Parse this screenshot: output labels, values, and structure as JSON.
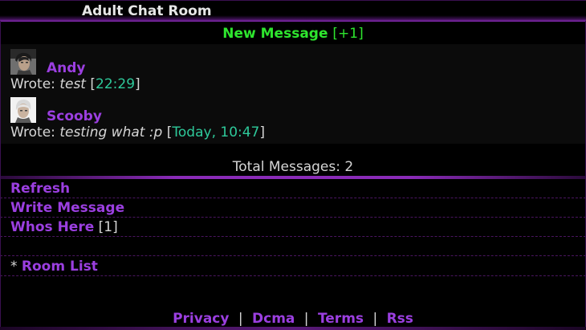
{
  "header": {
    "title": "Adult Chat Room"
  },
  "notice": {
    "label": "New Message",
    "count": "[+1]"
  },
  "messages": [
    {
      "username": "Andy",
      "prefix": "Wrote: ",
      "text": "test",
      "time_open": "[",
      "time": "22:29",
      "time_close": "]",
      "avatar_icon": "dark-haired-man-avatar-icon"
    },
    {
      "username": "Scooby",
      "prefix": "Wrote: ",
      "text": "testing what :p",
      "time_open": "[",
      "time": "Today, 10:47",
      "time_close": "]",
      "avatar_icon": "white-haired-man-avatar-icon"
    }
  ],
  "total": {
    "label": "Total Messages: 2"
  },
  "links": {
    "refresh": "Refresh",
    "write": "Write Message",
    "whos_here": "Whos Here",
    "whos_count": "[1]",
    "room_prefix": "* ",
    "room_list": "Room List"
  },
  "footer": {
    "privacy": "Privacy",
    "dcma": "Dcma",
    "terms": "Terms",
    "rss": "Rss",
    "separator": "|"
  },
  "colors": {
    "background": "#000000",
    "accent_purple": "#9b3fe0",
    "new_message_green": "#2ee52e",
    "time_teal": "#2ec99a"
  }
}
